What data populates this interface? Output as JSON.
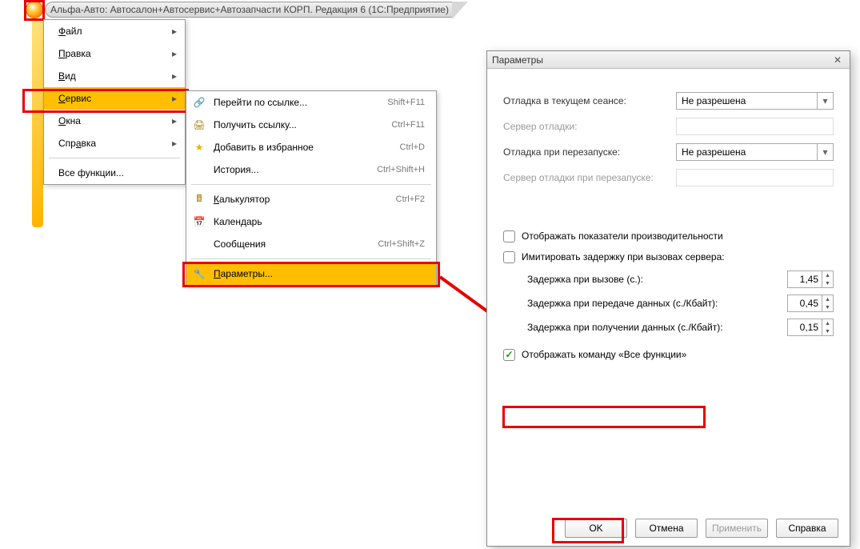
{
  "title": "Альфа-Авто: Автосалон+Автосервис+Автозапчасти КОРП. Редакция 6  (1С:Предприятие)",
  "menu": {
    "items": [
      {
        "label": "Файл",
        "u": 0,
        "arrow": true
      },
      {
        "label": "Правка",
        "u": 0,
        "arrow": true
      },
      {
        "label": "Вид",
        "u": 0,
        "arrow": true
      },
      {
        "label": "Сервис",
        "u": 0,
        "arrow": true,
        "hover": true
      },
      {
        "label": "Окна",
        "u": 0,
        "arrow": true
      },
      {
        "label": "Справка",
        "u": -1,
        "arrow": true
      }
    ],
    "all_functions": "Все функции..."
  },
  "submenu": {
    "items": [
      {
        "icon": "link",
        "label": "Перейти по ссылке...",
        "shortcut": "Shift+F11"
      },
      {
        "icon": "print",
        "label": "Получить ссылку...",
        "shortcut": "Ctrl+F11"
      },
      {
        "icon": "star",
        "label": "Добавить в избранное",
        "shortcut": "Ctrl+D"
      },
      {
        "icon": "",
        "label": "История...",
        "shortcut": "Ctrl+Shift+H"
      }
    ],
    "items2": [
      {
        "icon": "calc",
        "label": "Калькулятор",
        "u": 0,
        "shortcut": "Ctrl+F2"
      },
      {
        "icon": "cal",
        "label": "Календарь",
        "shortcut": ""
      },
      {
        "icon": "",
        "label": "Сообщения",
        "shortcut": "Ctrl+Shift+Z"
      }
    ],
    "param": {
      "icon": "wrench",
      "label": "Параметры...",
      "u": 0,
      "hover": true
    }
  },
  "dialog": {
    "title": "Параметры",
    "rows": {
      "debug_session": {
        "label": "Отладка в текущем сеансе:",
        "value": "Не разрешена"
      },
      "debug_server": {
        "label": "Сервер отладки:"
      },
      "debug_restart": {
        "label": "Отладка при перезапуске:",
        "value": "Не разрешена"
      },
      "debug_server_restart": {
        "label": "Сервер отладки при перезапуске:"
      }
    },
    "checks": {
      "perf": "Отображать показатели производительности",
      "imitate": "Имитировать задержку при вызовах сервера:",
      "all_funcs": "Отображать команду «Все функции»"
    },
    "spins": {
      "call": {
        "label": "Задержка при вызове (с.):",
        "value": "1,45"
      },
      "send": {
        "label": "Задержка при передаче данных (с./Кбайт):",
        "value": "0,45"
      },
      "recv": {
        "label": "Задержка при получении данных (с./Кбайт):",
        "value": "0,15"
      }
    },
    "buttons": {
      "ok": "OK",
      "cancel": "Отмена",
      "apply": "Применить",
      "help": "Справка"
    }
  }
}
